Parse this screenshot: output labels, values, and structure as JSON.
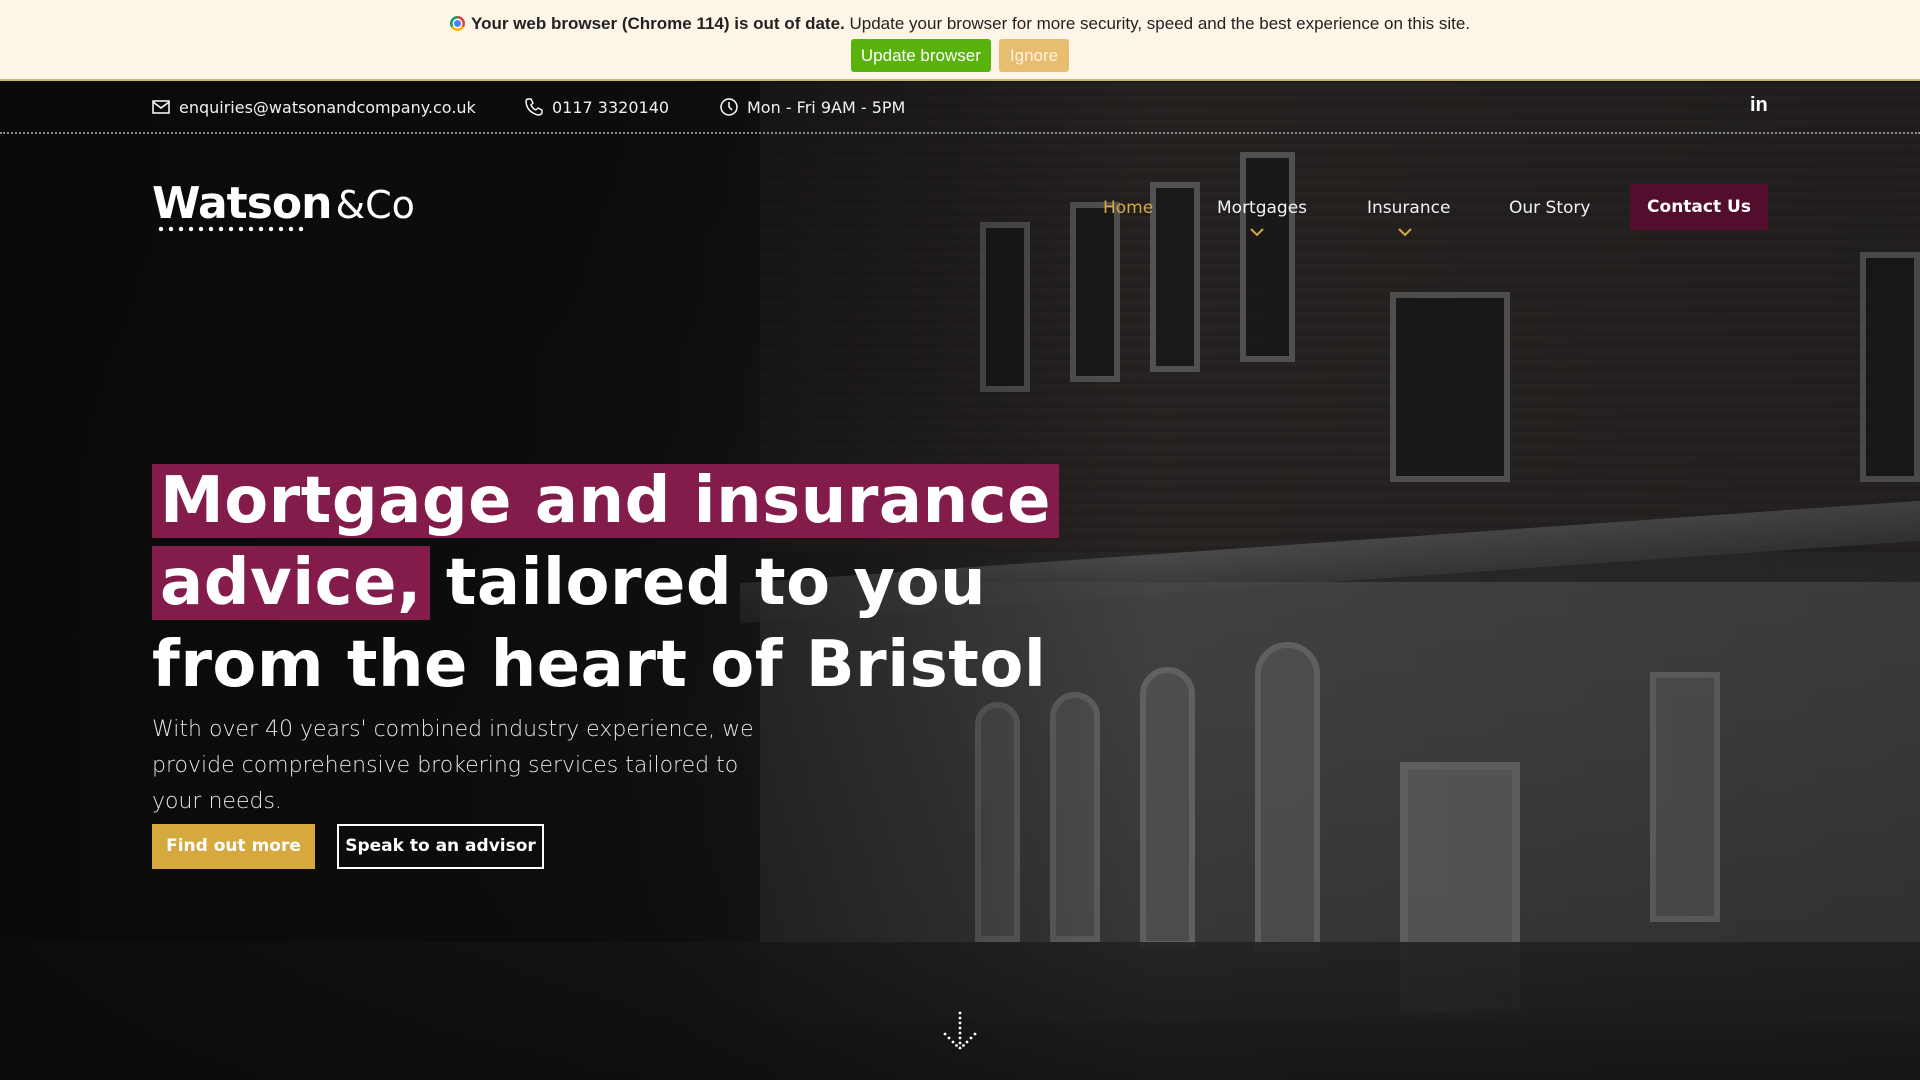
{
  "banner": {
    "icon": "chrome-icon",
    "bold_text": "Your web browser (Chrome 114) is out of date.",
    "text": " Update your browser for more security, speed and the best experience on this site.",
    "update_label": "Update browser",
    "ignore_label": "Ignore",
    "colors": {
      "background": "#fdf6e8",
      "update": "#5ab20c",
      "ignore": "#e9bd70"
    }
  },
  "topbar": {
    "email": {
      "icon": "mail-icon",
      "text": "enquiries@watsonandcompany.co.uk"
    },
    "phone": {
      "icon": "phone-icon",
      "text": "0117 3320140"
    },
    "hours": {
      "icon": "clock-icon",
      "text": "Mon - Fri 9AM - 5PM"
    },
    "social": {
      "icon": "linkedin-icon",
      "text": "in"
    }
  },
  "header": {
    "logo": {
      "wordmark": "Watson",
      "suffix": "&Co"
    },
    "nav": [
      {
        "label": "Home",
        "active": true
      },
      {
        "label": "Mortgages",
        "has_dropdown": true
      },
      {
        "label": "Insurance",
        "has_dropdown": true
      },
      {
        "label": "Our Story"
      }
    ],
    "contact_label": "Contact Us"
  },
  "hero": {
    "headline": {
      "line1_highlight": "Mortgage and insurance",
      "line2_highlight": "advice,",
      "line2_plain": "tailored to you",
      "line3": "from the heart of Bristol"
    },
    "subtext": "With over 40 years' combined industry experience, we provide comprehensive brokering services tailored to your needs.",
    "primary_cta": "Find out more",
    "secondary_cta": "Speak to an advisor",
    "scroll_icon": "arrow-down-icon"
  },
  "colors": {
    "accent_gold": "#d6a93f",
    "brand_plum": "#831b4b",
    "contact_plum": "#520e2c"
  }
}
